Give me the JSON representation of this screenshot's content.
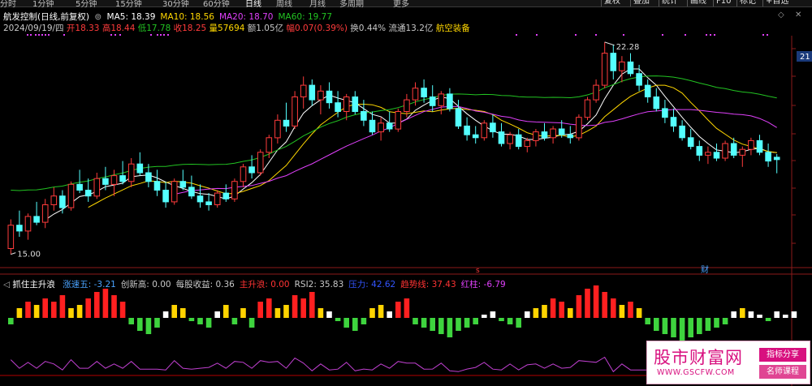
{
  "periods": [
    "分时",
    "1分钟",
    "5分钟",
    "15分钟",
    "30分钟",
    "60分钟",
    "日线",
    "周线",
    "月线",
    "多周期",
    "更多"
  ],
  "active_period": "日线",
  "toolbar_buttons": [
    "复权",
    "叠加",
    "统计",
    "画线",
    "F10",
    "标记",
    "+自选"
  ],
  "window_controls": {
    "restore": "◇",
    "close": "✕"
  },
  "header": {
    "title": "航发控制(日线,前复权)",
    "ma": [
      {
        "label": "MA5: 18.39",
        "color": "#ffffff"
      },
      {
        "label": "MA10: 18.56",
        "color": "#ffd700"
      },
      {
        "label": "MA20: 18.70",
        "color": "#e040fb"
      },
      {
        "label": "MA60: 19.77",
        "color": "#22c322"
      }
    ]
  },
  "quote": {
    "date": "2024/09/19/四",
    "open_label": "开",
    "open": "18.33",
    "high_label": "高",
    "high": "18.44",
    "low_label": "低",
    "low": "17.78",
    "close_label": "收",
    "close": "18.25",
    "vol_label": "量",
    "vol": "57694",
    "amt_label": "额",
    "amt": "1.05亿",
    "chg_label": "幅",
    "chg": "0.07(0.39%)",
    "turn_label": "换",
    "turn": "0.44%",
    "float_label": "流通",
    "float": "13.2亿",
    "sector": "航空装备"
  },
  "price_axis_tag": "21",
  "annotations": {
    "high": "22.28",
    "low": "15.00",
    "event_s": "s",
    "event_cai": "财"
  },
  "indicator": {
    "name": "抓住主升浪",
    "items": [
      {
        "label": "涨速五: -3.21",
        "color": "#4aa3ff"
      },
      {
        "label": "创新高: 0.00",
        "color": "#c8c8c8"
      },
      {
        "label": "每股收益: 0.36",
        "color": "#c8c8c8"
      },
      {
        "label": "主升浪: 0.00",
        "color": "#ff3333"
      },
      {
        "label": "RSI2: 35.83",
        "color": "#c8c8c8"
      },
      {
        "label": "压力: 42.62",
        "color": "#3355ff"
      },
      {
        "label": "趋势线: 37.43",
        "color": "#ff3333"
      },
      {
        "label": "红柱: -6.79",
        "color": "#e040fb"
      }
    ]
  },
  "watermark": {
    "brand": "股市财富网",
    "url": "WWW.GSCFW.COM",
    "tag1": "指标分享",
    "tag2": "名师课程"
  },
  "chart_data": {
    "type": "candlestick",
    "price_levels_shown": [
      "22.28",
      "15.00"
    ],
    "candles": [
      [
        15.2,
        16.2,
        15.0,
        16.0
      ],
      [
        16.0,
        16.5,
        15.6,
        15.8
      ],
      [
        15.8,
        16.4,
        15.5,
        16.3
      ],
      [
        16.3,
        16.8,
        16.0,
        16.1
      ],
      [
        16.1,
        16.9,
        15.9,
        16.7
      ],
      [
        16.7,
        17.3,
        16.5,
        17.0
      ],
      [
        17.0,
        17.2,
        16.4,
        16.6
      ],
      [
        16.6,
        17.5,
        16.5,
        17.4
      ],
      [
        17.4,
        17.9,
        17.1,
        17.2
      ],
      [
        17.2,
        17.6,
        16.8,
        17.0
      ],
      [
        17.0,
        17.8,
        16.9,
        17.6
      ],
      [
        17.6,
        18.0,
        17.2,
        17.4
      ],
      [
        17.4,
        17.9,
        17.0,
        17.7
      ],
      [
        17.7,
        18.2,
        17.4,
        17.5
      ],
      [
        17.5,
        18.3,
        17.3,
        18.1
      ],
      [
        18.1,
        18.5,
        17.7,
        17.8
      ],
      [
        17.8,
        18.1,
        17.3,
        17.5
      ],
      [
        17.5,
        17.9,
        17.0,
        17.2
      ],
      [
        17.2,
        17.5,
        16.6,
        16.8
      ],
      [
        16.8,
        17.6,
        16.7,
        17.5
      ],
      [
        17.5,
        17.9,
        17.2,
        17.3
      ],
      [
        17.3,
        17.7,
        16.9,
        17.0
      ],
      [
        17.0,
        17.4,
        16.6,
        16.8
      ],
      [
        16.8,
        17.1,
        16.5,
        16.7
      ],
      [
        16.7,
        17.2,
        16.6,
        17.1
      ],
      [
        17.1,
        17.4,
        16.8,
        16.9
      ],
      [
        16.9,
        17.6,
        16.8,
        17.5
      ],
      [
        17.5,
        18.1,
        17.3,
        18.0
      ],
      [
        18.0,
        18.4,
        17.6,
        17.8
      ],
      [
        17.8,
        18.6,
        17.7,
        18.5
      ],
      [
        18.5,
        19.1,
        18.3,
        19.0
      ],
      [
        19.0,
        19.8,
        18.8,
        19.6
      ],
      [
        19.6,
        20.2,
        19.2,
        19.4
      ],
      [
        19.4,
        20.6,
        19.3,
        20.4
      ],
      [
        20.4,
        21.1,
        20.0,
        20.8
      ],
      [
        20.8,
        21.0,
        20.1,
        20.3
      ],
      [
        20.3,
        20.8,
        19.8,
        20.6
      ],
      [
        20.6,
        20.9,
        20.0,
        20.2
      ],
      [
        20.2,
        20.6,
        19.7,
        19.9
      ],
      [
        19.9,
        20.5,
        19.6,
        20.4
      ],
      [
        20.4,
        20.6,
        19.8,
        19.9
      ],
      [
        19.9,
        20.3,
        19.4,
        19.6
      ],
      [
        19.6,
        19.9,
        19.1,
        19.2
      ],
      [
        19.2,
        19.7,
        18.9,
        19.5
      ],
      [
        19.5,
        19.9,
        19.2,
        19.3
      ],
      [
        19.3,
        20.0,
        19.2,
        19.9
      ],
      [
        19.9,
        20.5,
        19.7,
        20.3
      ],
      [
        20.3,
        20.9,
        20.1,
        20.7
      ],
      [
        20.7,
        21.0,
        20.2,
        20.4
      ],
      [
        20.4,
        20.8,
        19.9,
        20.1
      ],
      [
        20.1,
        20.6,
        19.8,
        20.5
      ],
      [
        20.5,
        20.7,
        19.9,
        20.0
      ],
      [
        20.0,
        20.3,
        19.3,
        19.4
      ],
      [
        19.4,
        19.7,
        18.9,
        19.1
      ],
      [
        19.1,
        19.4,
        18.8,
        19.0
      ],
      [
        19.0,
        19.6,
        18.9,
        19.5
      ],
      [
        19.5,
        19.8,
        19.0,
        19.2
      ],
      [
        19.2,
        19.5,
        18.7,
        18.8
      ],
      [
        18.8,
        19.2,
        18.6,
        19.1
      ],
      [
        19.1,
        19.3,
        18.6,
        18.7
      ],
      [
        18.7,
        19.0,
        18.5,
        18.9
      ],
      [
        18.9,
        19.3,
        18.7,
        19.2
      ],
      [
        19.2,
        19.5,
        18.9,
        19.0
      ],
      [
        19.0,
        19.4,
        18.8,
        19.3
      ],
      [
        19.3,
        19.6,
        19.0,
        19.1
      ],
      [
        19.1,
        19.4,
        18.8,
        19.0
      ],
      [
        19.0,
        19.8,
        18.9,
        19.7
      ],
      [
        19.7,
        20.4,
        19.6,
        20.3
      ],
      [
        20.3,
        21.0,
        20.2,
        20.8
      ],
      [
        20.8,
        22.28,
        20.7,
        21.9
      ],
      [
        21.9,
        22.2,
        21.0,
        21.3
      ],
      [
        21.3,
        21.8,
        20.9,
        21.6
      ],
      [
        21.6,
        21.9,
        21.1,
        21.2
      ],
      [
        21.2,
        21.5,
        20.6,
        20.8
      ],
      [
        20.8,
        21.0,
        20.2,
        20.4
      ],
      [
        20.4,
        20.7,
        19.9,
        20.0
      ],
      [
        20.0,
        20.3,
        19.5,
        19.7
      ],
      [
        19.7,
        20.0,
        19.2,
        19.4
      ],
      [
        19.4,
        19.6,
        18.9,
        19.0
      ],
      [
        19.0,
        19.3,
        18.6,
        18.7
      ],
      [
        18.7,
        18.9,
        18.2,
        18.4
      ],
      [
        18.4,
        18.7,
        18.1,
        18.5
      ],
      [
        18.5,
        18.8,
        18.2,
        18.3
      ],
      [
        18.3,
        18.9,
        18.2,
        18.8
      ],
      [
        18.8,
        19.0,
        18.3,
        18.4
      ],
      [
        18.4,
        18.7,
        18.0,
        18.6
      ],
      [
        18.6,
        19.0,
        18.4,
        18.9
      ],
      [
        18.9,
        19.1,
        18.4,
        18.5
      ],
      [
        18.5,
        18.8,
        18.0,
        18.2
      ],
      [
        18.33,
        18.44,
        17.78,
        18.25
      ]
    ],
    "indicator_bars": [
      -2,
      3,
      5,
      4,
      6,
      5,
      7,
      3,
      4,
      6,
      8,
      9,
      7,
      5,
      -2,
      -4,
      -5,
      -3,
      2,
      4,
      3,
      -1,
      -2,
      -3,
      2,
      4,
      -2,
      3,
      -3,
      5,
      6,
      3,
      4,
      7,
      6,
      8,
      3,
      2,
      -1,
      -3,
      -4,
      -2,
      3,
      4,
      2,
      5,
      6,
      -2,
      -3,
      -4,
      -5,
      -6,
      -4,
      -3,
      -2,
      1,
      2,
      -1,
      -2,
      -3,
      2,
      3,
      4,
      6,
      5,
      3,
      7,
      9,
      10,
      8,
      6,
      4,
      5,
      3,
      -2,
      -4,
      -5,
      -6,
      -7,
      -6,
      -5,
      -4,
      -3,
      -2,
      2,
      3,
      2,
      1,
      -1,
      2,
      1,
      2
    ]
  }
}
